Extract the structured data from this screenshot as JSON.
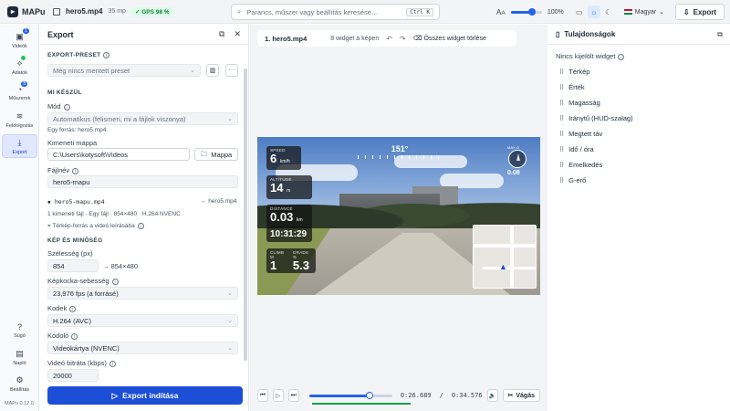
{
  "app": {
    "name": "MAPu",
    "version": "MAPu 0.12.0"
  },
  "topbar": {
    "file_name": "hero5.mp4",
    "file_size": "35 mp",
    "gps_badge": "GPS 98 %",
    "search_placeholder": "Parancs, műszer vagy beállítás keresése…",
    "search_shortcut": "Ctrl K",
    "zoom": "100%",
    "language": "Magyar",
    "export_label": "Export"
  },
  "rail": {
    "items": [
      {
        "label": "Videók",
        "badge": "1"
      },
      {
        "label": "Adatok"
      },
      {
        "label": "Műszerek",
        "badge": "8"
      },
      {
        "label": "Feldolgozás"
      },
      {
        "label": "Export"
      }
    ],
    "bottom": [
      {
        "label": "Súgó"
      },
      {
        "label": "Napló"
      },
      {
        "label": "Beállítás"
      }
    ]
  },
  "export_panel": {
    "title": "Export",
    "preset_section": "EXPORT-PRESET",
    "preset_placeholder": "Még nincs mentett preset",
    "mi_section": "MI KÉSZÜL",
    "mode_label": "Mód",
    "mode_value": "Automatikus (felismeri, mi a fájlok viszonya)",
    "source_note": "Egy forrás: hero5.mp4.",
    "folder_label": "Kimeneti mappa",
    "folder_value": "C:\\Users\\kotysoft\\Videos",
    "folder_button": "Mappa",
    "filename_label": "Fájlnév",
    "filename_value": "hero5-mapu",
    "output_file": "hero5-mapu.mp4",
    "output_source": "← hero5.mp4",
    "output_summary": "1 kimeneti fájl · Egy fájl · 854×480 · H.264 NVENC",
    "map_source": "Térkép-forrás a videó leírásába",
    "quality_section": "KÉP ÉS MINŐSÉG",
    "width_label": "Szélesség (px)",
    "width_value": "854",
    "width_result": "→ 854×480",
    "fps_label": "Képkocka-sebesség",
    "fps_value": "23,976 fps (a forrásé)",
    "codec_label": "Kodek",
    "codec_value": "H.264 (AVC)",
    "encoder_label": "Kódoló",
    "encoder_value": "Videókártya (NVENC)",
    "bitrate_label": "Videó bitráta (kbps)",
    "bitrate_value": "20000",
    "start_button": "Export indítása"
  },
  "center": {
    "video_title": "1. hero5.mp4",
    "widget_count": "8 widget a képen",
    "clear_all": "Összes widget törlése",
    "hud": {
      "speed_label": "SPEED",
      "speed_value": "6",
      "speed_unit": "km/h",
      "heading": "151°",
      "altitude_label": "ALTITUDE",
      "altitude_value": "14",
      "altitude_unit": "m",
      "distance_label": "DISTANCE",
      "distance_value": "0.03",
      "distance_unit": "km",
      "clock": "10:31:29",
      "climb_label": "CLIMB M",
      "climb_value": "1",
      "grade_label": "GRADE %",
      "grade_value": "5.3",
      "gforce_label": "MAX G",
      "gforce_value": "0.08"
    },
    "playback": {
      "current": "0:26.689",
      "separator": "/",
      "total": "0:34.576",
      "progress": 0.73,
      "gps_coverage": 0.98,
      "cut_label": "Vágás"
    }
  },
  "properties": {
    "title": "Tulajdonságok",
    "no_selection": "Nincs kijelölt widget",
    "widgets": [
      "Térkép",
      "Érték",
      "Magasság",
      "Iránytű (HUD-szalag)",
      "Megtett táv",
      "Idő / óra",
      "Emelkedés",
      "G-erő"
    ]
  },
  "colors": {
    "accent": "#1d4ed8",
    "gps_ok": "#16a34a"
  }
}
